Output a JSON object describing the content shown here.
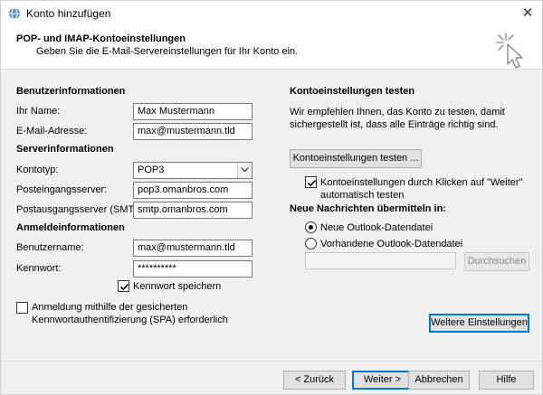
{
  "window": {
    "title": "Konto hinzufügen",
    "close_label": "✕"
  },
  "header": {
    "title": "POP- und IMAP-Kontoeinstellungen",
    "subtitle": "Geben Sie die E-Mail-Servereinstellungen für Ihr Konto ein."
  },
  "user_info": {
    "section": "Benutzerinformationen",
    "name_label": "Ihr Name:",
    "name_value": "Max Mustermann",
    "email_label": "E-Mail-Adresse:",
    "email_value": "max@mustermann.tld"
  },
  "server_info": {
    "section": "Serverinformationen",
    "account_type_label": "Kontotyp:",
    "account_type_value": "POP3",
    "incoming_label": "Posteingangsserver:",
    "incoming_value": "pop3.omanbros.com",
    "outgoing_label": "Postausgangsserver (SMTP):",
    "outgoing_value": "smtp.omanbros.com"
  },
  "login_info": {
    "section": "Anmeldeinformationen",
    "username_label": "Benutzername:",
    "username_value": "max@mustermann.tld",
    "password_label": "Kennwort:",
    "password_value": "**********",
    "remember_label": "Kennwort speichern",
    "remember_checked": true
  },
  "spa": {
    "label_line1": "Anmeldung mithilfe der gesicherten",
    "label_line2": "Kennwortauthentifizierung (SPA) erforderlich",
    "checked": false
  },
  "test": {
    "section": "Kontoeinstellungen testen",
    "desc_line1": "Wir empfehlen Ihnen, das Konto zu testen, damit",
    "desc_line2": "sichergestellt ist, dass alle Einträge richtig sind.",
    "button": "Kontoeinstellungen testen ...",
    "auto_line1": "Kontoeinstellungen durch Klicken auf \"Weiter\"",
    "auto_line2": "automatisch testen",
    "auto_checked": true
  },
  "delivery": {
    "section": "Neue Nachrichten übermitteln in:",
    "option_new": "Neue Outlook-Datendatei",
    "option_existing": "Vorhandene Outlook-Datendatei",
    "selected": "new",
    "path_value": "",
    "browse_button": "Durchsuchen"
  },
  "more_settings_button": "Weitere Einstellungen",
  "footer": {
    "back": "< Zurück",
    "next": "Weiter >",
    "cancel": "Abbrechen",
    "help": "Hilfe"
  }
}
